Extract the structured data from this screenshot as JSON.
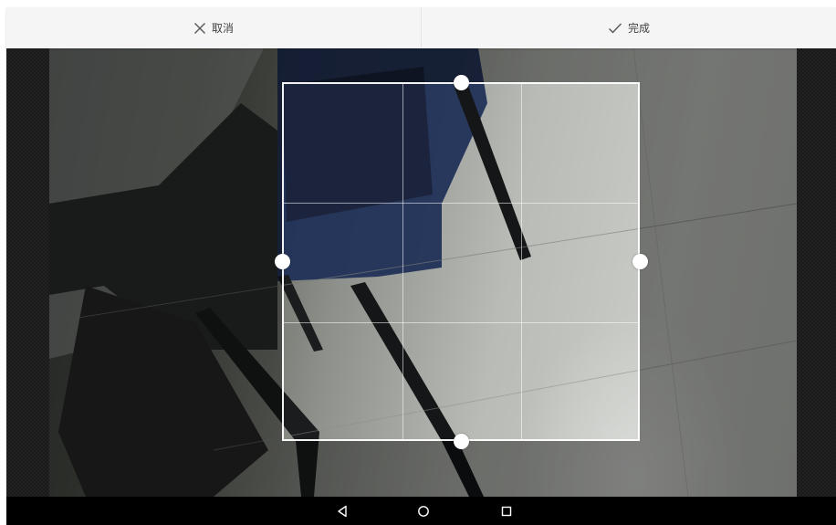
{
  "toolbar": {
    "cancel_label": "取消",
    "cancel_icon": "close-icon",
    "done_label": "完成",
    "done_icon": "check-icon",
    "background": "#f5f5f5",
    "text_color": "#424242"
  },
  "crop": {
    "overlay_color": "rgba(0,0,0,0.42)",
    "border_color": "#ffffff",
    "grid": "3x3"
  },
  "navigation": {
    "back_icon": "back-triangle-icon",
    "home_icon": "home-circle-icon",
    "recents_icon": "recents-square-icon",
    "background": "#000000"
  }
}
